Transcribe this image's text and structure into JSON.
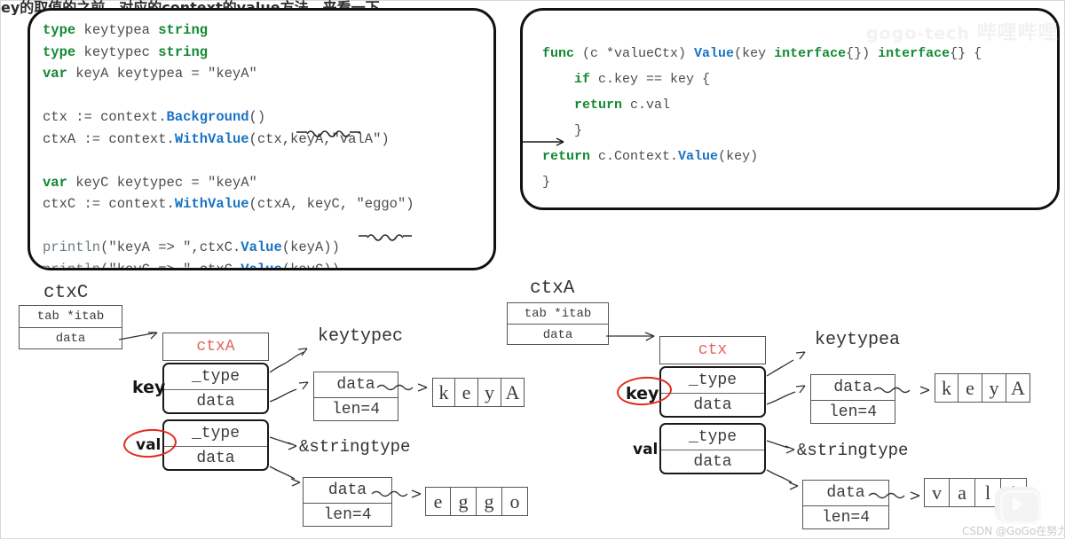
{
  "header": {
    "clipped_note": "ey的取值的之前，对应的context的value方法。来看一下"
  },
  "watermarks": {
    "bilibili": "gogo-tech",
    "bilibili_cn": "哔哩哔哩",
    "csdn": "CSDN @GoGo在努力"
  },
  "code_left": {
    "lines": [
      [
        {
          "t": "type",
          "c": "kw"
        },
        {
          "t": " keytypea ",
          "c": "pl"
        },
        {
          "t": "string",
          "c": "kw"
        }
      ],
      [
        {
          "t": "type",
          "c": "kw"
        },
        {
          "t": " keytypec ",
          "c": "pl"
        },
        {
          "t": "string",
          "c": "kw"
        }
      ],
      [
        {
          "t": "var",
          "c": "kw"
        },
        {
          "t": " keyA keytypea = \"keyA\"",
          "c": "pl"
        }
      ],
      [
        {
          "t": "",
          "c": "pl"
        }
      ],
      [
        {
          "t": "ctx := context.",
          "c": "pl"
        },
        {
          "t": "Background",
          "c": "fn"
        },
        {
          "t": "()",
          "c": "pl"
        }
      ],
      [
        {
          "t": "ctxA := context.",
          "c": "pl"
        },
        {
          "t": "WithValue",
          "c": "fn"
        },
        {
          "t": "(ctx,keyA,\"valA\")",
          "c": "pl"
        }
      ],
      [
        {
          "t": "",
          "c": "pl"
        }
      ],
      [
        {
          "t": "var",
          "c": "kw"
        },
        {
          "t": " keyC keytypec = \"keyA\"",
          "c": "pl"
        }
      ],
      [
        {
          "t": "ctxC := context.",
          "c": "pl"
        },
        {
          "t": "WithValue",
          "c": "fn"
        },
        {
          "t": "(ctxA, keyC, \"eggo\")",
          "c": "pl"
        }
      ],
      [
        {
          "t": "",
          "c": "pl"
        }
      ],
      [
        {
          "t": "println",
          "c": "gy"
        },
        {
          "t": "(\"keyA => \",ctxC.",
          "c": "pl"
        },
        {
          "t": "Value",
          "c": "fn"
        },
        {
          "t": "(keyA))",
          "c": "pl"
        }
      ],
      [
        {
          "t": "println",
          "c": "gy"
        },
        {
          "t": "(\"keyC => \",ctxC.",
          "c": "pl"
        },
        {
          "t": "Value",
          "c": "fn"
        },
        {
          "t": "(keyC))",
          "c": "pl"
        }
      ]
    ]
  },
  "code_right": {
    "lines": [
      [
        {
          "t": "func",
          "c": "kw"
        },
        {
          "t": " (c *valueCtx) ",
          "c": "pl"
        },
        {
          "t": "Value",
          "c": "fn"
        },
        {
          "t": "(key ",
          "c": "pl"
        },
        {
          "t": "interface",
          "c": "kw"
        },
        {
          "t": "{}) ",
          "c": "pl"
        },
        {
          "t": "interface",
          "c": "kw"
        },
        {
          "t": "{} {",
          "c": "pl"
        }
      ],
      [
        {
          "t": "    ",
          "c": "pl"
        },
        {
          "t": "if",
          "c": "kw"
        },
        {
          "t": " c.key == key {",
          "c": "pl"
        }
      ],
      [
        {
          "t": "    ",
          "c": "pl"
        },
        {
          "t": "return",
          "c": "kw"
        },
        {
          "t": " c.val",
          "c": "pl"
        }
      ],
      [
        {
          "t": "    }",
          "c": "pl"
        }
      ],
      [
        {
          "t": "",
          "c": "pl"
        },
        {
          "t": "return",
          "c": "kw"
        },
        {
          "t": " c.Context.",
          "c": "pl"
        },
        {
          "t": "Value",
          "c": "fn"
        },
        {
          "t": "(key)",
          "c": "pl"
        }
      ],
      [
        {
          "t": "}",
          "c": "pl"
        }
      ]
    ]
  },
  "diagram_left": {
    "title": "ctxC",
    "iface": {
      "row1": "tab *itab",
      "row2": "data"
    },
    "struct_title": "ctxA",
    "key_label": "key",
    "val_label": "val",
    "key_iface": {
      "row1": "_type",
      "row2": "data"
    },
    "val_iface": {
      "row1": "_type",
      "row2": "data"
    },
    "type_name": "keytypec",
    "string_hdr_key": {
      "row1": "data",
      "row2": "len=4"
    },
    "key_chars": [
      "k",
      "e",
      "y",
      "A"
    ],
    "val_type_name": "&stringtype",
    "string_hdr_val": {
      "row1": "data",
      "row2": "len=4"
    },
    "val_chars": [
      "e",
      "g",
      "g",
      "o"
    ]
  },
  "diagram_right": {
    "title": "ctxA",
    "iface": {
      "row1": "tab *itab",
      "row2": "data"
    },
    "struct_title": "ctx",
    "key_label": "key",
    "val_label": "val",
    "key_iface": {
      "row1": "_type",
      "row2": "data"
    },
    "val_iface": {
      "row1": "_type",
      "row2": "data"
    },
    "type_name": "keytypea",
    "string_hdr_key": {
      "row1": "data",
      "row2": "len=4"
    },
    "key_chars": [
      "k",
      "e",
      "y",
      "A"
    ],
    "val_type_name": "&stringtype",
    "string_hdr_val": {
      "row1": "data",
      "row2": "len=4"
    },
    "val_chars": [
      "v",
      "a",
      "l",
      "A"
    ]
  },
  "colors": {
    "keyword": "#128a33",
    "function": "#1a73c4",
    "struct_title": "#e0645c",
    "highlight_ellipse": "#e02b1d"
  }
}
